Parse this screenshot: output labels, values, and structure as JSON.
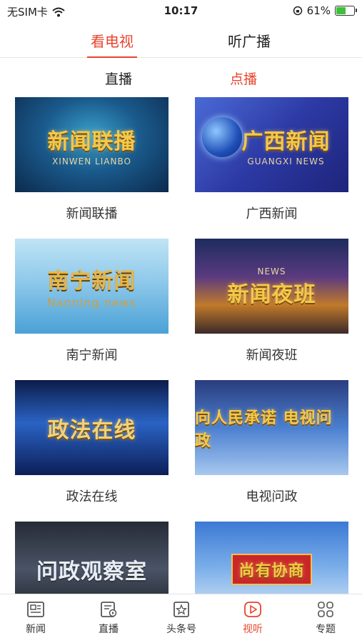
{
  "status_bar": {
    "carrier": "无SIM卡",
    "time": "10:17",
    "battery": "61%",
    "battery_level": 0.61
  },
  "top_tabs": {
    "tv": "看电视",
    "radio": "听广播",
    "active": "tv"
  },
  "sub_tabs": {
    "live": "直播",
    "vod": "点播",
    "active": "vod"
  },
  "programs": [
    {
      "label": "新闻联播",
      "thumb_title": "新闻联播",
      "thumb_sub": "XINWEN LIANBO"
    },
    {
      "label": "广西新闻",
      "thumb_title": "广西新闻",
      "thumb_sub": "GUANGXI NEWS"
    },
    {
      "label": "南宁新闻",
      "thumb_title": "南宁新闻",
      "thumb_sub": "Nanning news"
    },
    {
      "label": "新闻夜班",
      "thumb_title": "新闻夜班",
      "thumb_sub": "NEWS"
    },
    {
      "label": "政法在线",
      "thumb_title": "政法在线",
      "thumb_sub": ""
    },
    {
      "label": "电视问政",
      "thumb_title": "向人民承诺 电视问政",
      "thumb_sub": ""
    },
    {
      "label": "",
      "thumb_title": "问政观察室",
      "thumb_sub": ""
    },
    {
      "label": "",
      "thumb_title": "尚有协商",
      "thumb_sub": ""
    }
  ],
  "bottom_nav": [
    {
      "label": "新闻",
      "icon": "news-icon"
    },
    {
      "label": "直播",
      "icon": "live-icon"
    },
    {
      "label": "头条号",
      "icon": "headline-icon"
    },
    {
      "label": "视听",
      "icon": "play-icon"
    },
    {
      "label": "专题",
      "icon": "topics-icon"
    }
  ],
  "colors": {
    "accent": "#e8452e",
    "text": "#222222"
  }
}
